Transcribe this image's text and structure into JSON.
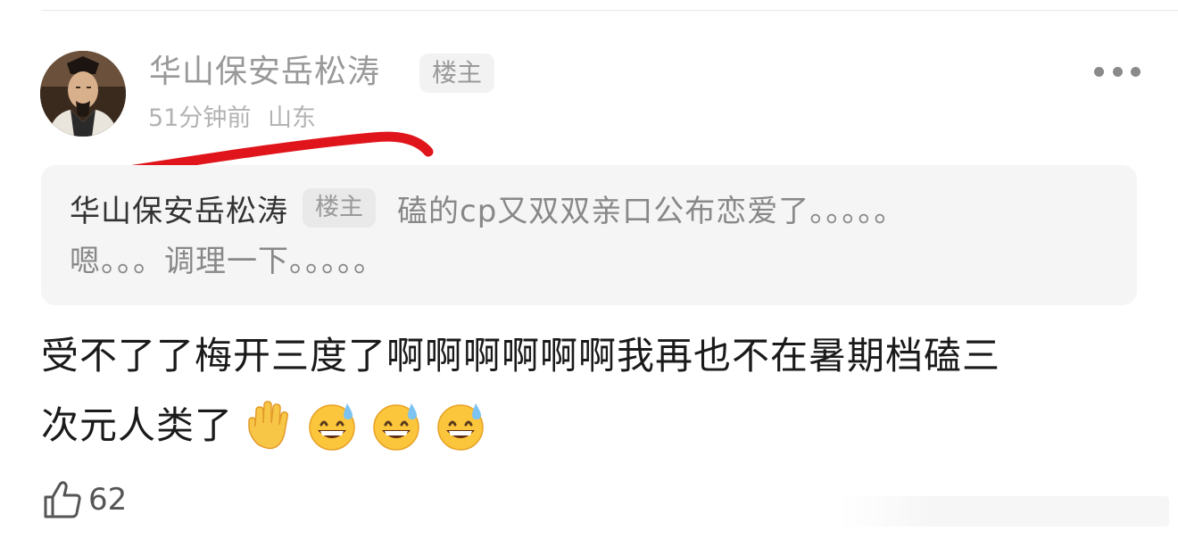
{
  "post": {
    "username": "华山保安岳松涛",
    "op_badge": "楼主",
    "time_ago": "51分钟前",
    "location": "山东"
  },
  "quote": {
    "author": "华山保安岳松涛",
    "badge": "楼主",
    "text_line1": "磕的cp又双双亲口公布恋爱了。。。。。",
    "text_line2": "嗯。。。调理一下。。。。。"
  },
  "comment": {
    "line1": "受不了了梅开三度了啊啊啊啊啊啊我再也不在暑期档磕三",
    "line2": "次元人类了"
  },
  "emojis": [
    "raised-hand-emoji",
    "grinning-sweat-emoji",
    "grinning-sweat-emoji",
    "grinning-sweat-emoji"
  ],
  "likes": {
    "count": "62",
    "icon": "thumbs-up-icon"
  },
  "icons": {
    "more": "more-dots-icon"
  },
  "colors": {
    "annotation_red": "#e0141b",
    "muted_text": "#999999",
    "quote_bg": "#f5f5f5"
  }
}
